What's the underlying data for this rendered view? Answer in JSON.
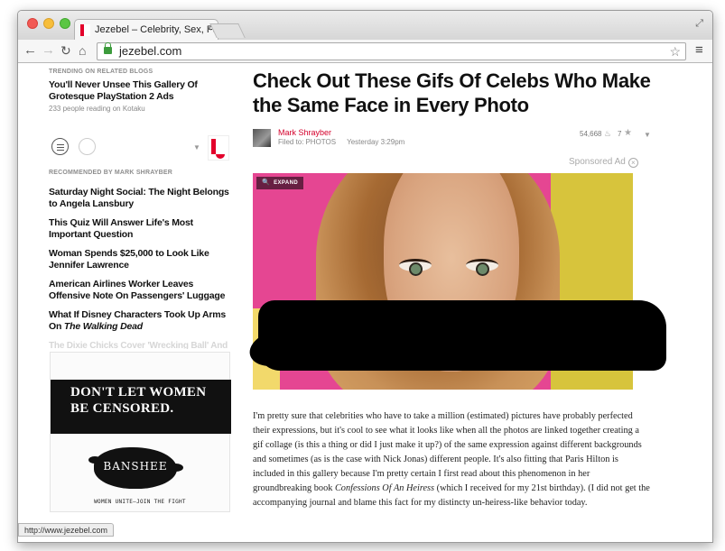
{
  "browser": {
    "tab_title": "Jezebel – Celebrity, Sex, Fas",
    "tab_close": "×",
    "url": "jezebel.com",
    "status_url": "http://www.jezebel.com"
  },
  "icons": {
    "back": "arrow-left-icon",
    "forward": "arrow-right-icon",
    "reload": "reload-icon",
    "home": "home-icon",
    "bookmark": "star-outline-icon",
    "menu": "hamburger-menu-icon"
  },
  "sidebar": {
    "trending_label": "TRENDING ON RELATED BLOGS",
    "trending_title": "You'll Never Unsee This Gallery Of Grotesque PlayStation 2 Ads",
    "trending_meta": "233 people reading on Kotaku",
    "recommended_label": "RECOMMENDED BY MARK SHRAYBER",
    "recommended": [
      {
        "title": "Saturday Night Social: The Night Belongs to Angela Lansbury"
      },
      {
        "title": "This Quiz Will Answer Life's Most Important Question"
      },
      {
        "title": "Woman Spends $25,000 to Look Like Jennifer Lawrence"
      },
      {
        "title": "American Airlines Worker Leaves Offensive Note On Passengers' Luggage"
      }
    ],
    "recommended_last_prefix": "What If Disney Characters Took Up Arms On ",
    "recommended_last_italic": "The Walking Dead",
    "recommended_faded": "The Dixie Chicks Cover 'Wrecking Ball' And It's"
  },
  "ad": {
    "headline_line1": "DON'T LET WOMEN",
    "headline_line2": "BE CENSORED.",
    "brand": "BANSHEE",
    "tagline": "WOMEN UNITE—JOIN THE FIGHT"
  },
  "article": {
    "title": "Check Out These Gifs Of Celebs Who Make the Same Face in Every Photo",
    "author": "Mark Shrayber",
    "filed_prefix": "Filed to:",
    "filed_category": "PHOTOS",
    "timestamp": "Yesterday 3:29pm",
    "views": "54,668",
    "likes": "7",
    "sponsored": "Sponsored Ad",
    "expand_label": "EXPAND",
    "body_p1": "I'm pretty sure that celebrities who have to take a million (estimated) pictures have probably perfected their expressions, but it's cool to see what it looks like when all the photos are linked together creating a gif collage (is this a thing or did I just make it up?) of the same expression against different backgrounds and sometimes (as is the case with Nick Jonas) different people. It's also fitting that Paris Hilton is included in this gallery because I'm pretty certain I first read about this phenomenon in her groundbreaking book ",
    "body_italic": "Confessions Of An Heiress",
    "body_p2": " (which I received for my 21st birthday). (I did not get the accompanying journal and blame this fact for my distincty un-heiress-like behavior today."
  },
  "colors": {
    "brand_red": "#e3002b",
    "author_red": "#d4002b",
    "photo_pink": "#e54692"
  }
}
